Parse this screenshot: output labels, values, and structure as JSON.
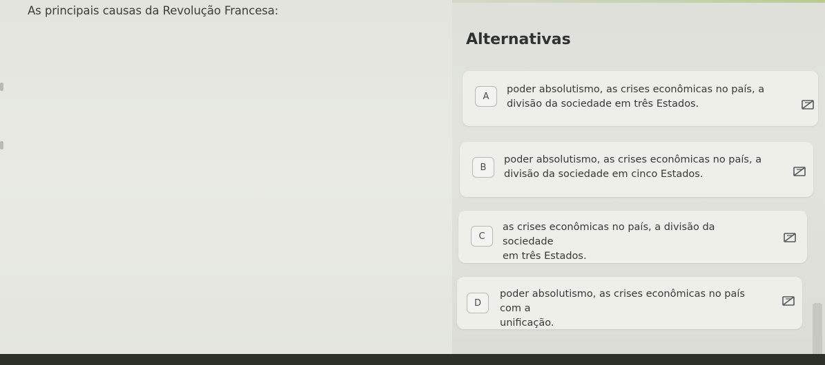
{
  "question": {
    "text": "As principais causas da Revolução Francesa:"
  },
  "alternatives": {
    "title": "Alternativas",
    "options": [
      {
        "letter": "A",
        "line1": "poder absolutismo, as crises econômicas no país, a",
        "line2": "divisão  da sociedade em três Estados."
      },
      {
        "letter": "B",
        "line1": "poder absolutismo,  as crises econômicas no país,  a",
        "line2": "divisão  da sociedade em cinco Estados."
      },
      {
        "letter": "C",
        "line1": "as crises econômicas no país,  a divisão  da sociedade",
        "line2": "em três Estados."
      },
      {
        "letter": "D",
        "line1": "poder absolutismo,  as crises econômicas no país com a",
        "line2": "unificação."
      }
    ]
  },
  "icons": {
    "strike_option": "eraser-strikethrough-icon"
  }
}
